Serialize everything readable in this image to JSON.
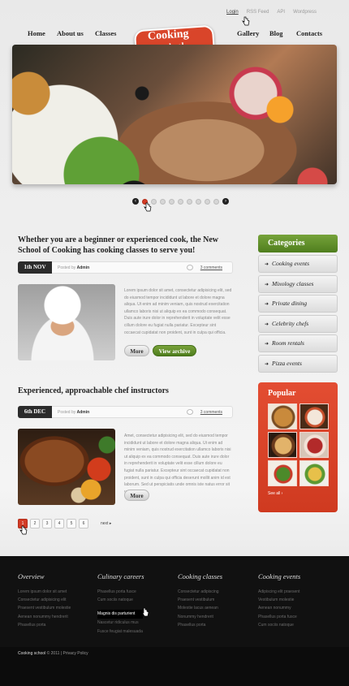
{
  "top_links": [
    "Login",
    "RSS Feed",
    "API",
    "Wordpress"
  ],
  "nav": {
    "home": "Home",
    "about": "About us",
    "classes": "Classes",
    "gallery": "Gallery",
    "blog": "Blog",
    "contacts": "Contacts"
  },
  "logo": {
    "line1": "Cooking",
    "line2": "school"
  },
  "slider": {
    "total": 9,
    "active": 1,
    "prev": "‹",
    "next": "›"
  },
  "post1": {
    "headline": "Whether you are a beginner or experienced cook, the New School of Cooking has cooking classes to serve you!",
    "date": "1th NOV",
    "posted_by_label": "Posted by",
    "author": "Admin",
    "comments": "3 comments",
    "body": "Lorem ipsum dolor sit amet, consectetur adipisicing elit, sed do eiusmod tempor incididunt ut labore et dolore magna aliqua. Ut enim ad minim veniam, quis nostrud exercitation ullamco laboris nisi ut aliquip ex ea commodo consequat. Duis aute irure dolor in reprehenderit in voluptate velit esse cillum dolore eu fugiat nulla pariatur. Excepteur sint occaecat cupidatat non proident, sunt in culpa qui officia.",
    "more": "More",
    "view_archive": "View archive"
  },
  "post2": {
    "title": "Experienced, approachable chef instructors",
    "date": "6th DEC",
    "posted_by_label": "Posted by",
    "author": "Admin",
    "comments": "3 comments",
    "body": "Amet, consectetur adipisicing elit, sed do eiusmod tempor incididunt ut labore et dolore magna aliqua. Ut enim ad minim veniam, quis nostrud exercitation ullamco laboris nisi ut aliquip ex ea commodo consequat. Duis aute irure dolor in reprehenderit in voluptate velit esse cillum dolore eu fugiat nulla pariatur. Excepteur sint occaecat cupidatat non proident, sunt in culpa qui officia deserunt mollit anim id est laborum. Sed ut perspiciatis unde omnis iste natus error sit voluptatem.",
    "more": "More"
  },
  "pagination": {
    "pages": [
      "1",
      "2",
      "3",
      "4",
      "5",
      "6"
    ],
    "active": "1",
    "next": "next ▸"
  },
  "sidebar": {
    "categories_title": "Categories",
    "categories": [
      "Cooking events",
      "Mixology classes",
      "Private dining",
      "Celebrity chefs",
      "Room rentals",
      "Pizza events"
    ],
    "popular_title": "Popular",
    "see_all": "See all ›"
  },
  "footer": {
    "columns": [
      {
        "title": "Overview",
        "links": [
          "Lorem ipsum dolor sit amet",
          "Consectetur adipisicing elit",
          "Praesent vestibulum molestie",
          "Aenean nonummy hendrerit",
          "Phasellus porta"
        ]
      },
      {
        "title": "Culinary careers",
        "links": [
          "Phasellus porta fusce",
          "Cum sociis natoque",
          "Magnis dis parturient",
          "Nascetur ridiculus mus",
          "Fusce feugiat malesuada"
        ]
      },
      {
        "title": "Cooking classes",
        "links": [
          "Consectetur adipiscing",
          "Praesent vestibulum",
          "Molestie lacus aenean",
          "Nonummy hendrerit",
          "Phasellus porta"
        ]
      },
      {
        "title": "Cooking events",
        "links": [
          "Adipiscing elit praesent",
          "Vestibulum molestie",
          "Aenean nonummy",
          "Phasellus porta fusce",
          "Cum sociis natoque"
        ]
      }
    ],
    "highlighted_link": "Magnis dis parturient",
    "copyright_brand": "Cooking school",
    "copyright_text": "© 2011 | Privacy Policy"
  },
  "colors": {
    "accent_red": "#d33b25",
    "accent_green": "#5a8a26",
    "footer_bg": "#111111"
  }
}
